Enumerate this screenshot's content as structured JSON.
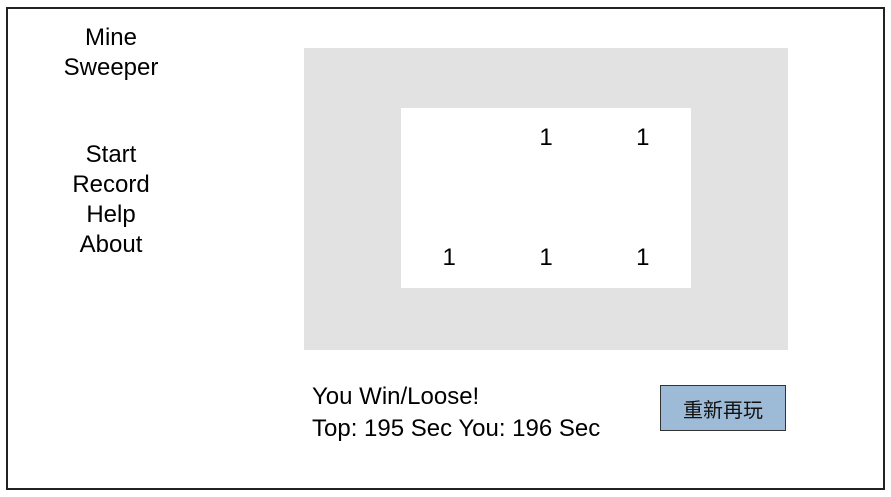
{
  "app": {
    "title_line1": "Mine",
    "title_line2": "Sweeper"
  },
  "sidebar": {
    "items": [
      {
        "label": "Start"
      },
      {
        "label": "Record"
      },
      {
        "label": "Help"
      },
      {
        "label": "About"
      }
    ]
  },
  "board": {
    "cols": 5,
    "rows": 5,
    "cells": [
      [
        "",
        "",
        "",
        "",
        ""
      ],
      [
        "",
        "",
        "1",
        "1",
        ""
      ],
      [
        "",
        "",
        "",
        "",
        ""
      ],
      [
        "",
        "1",
        "1",
        "1",
        ""
      ],
      [
        "",
        "",
        "",
        "",
        ""
      ]
    ],
    "revealed": [
      [
        false,
        false,
        false,
        false,
        false
      ],
      [
        false,
        true,
        true,
        true,
        false
      ],
      [
        false,
        true,
        true,
        true,
        false
      ],
      [
        false,
        true,
        true,
        true,
        false
      ],
      [
        false,
        false,
        false,
        false,
        false
      ]
    ],
    "colors": {
      "unrevealed": "#e2e2e2",
      "revealed": "#ffffff"
    }
  },
  "status": {
    "result": "You Win/Loose!",
    "score": "Top: 195 Sec You: 196 Sec"
  },
  "actions": {
    "replay_label": "重新再玩"
  },
  "colors": {
    "button_bg": "#9dbbd6"
  }
}
